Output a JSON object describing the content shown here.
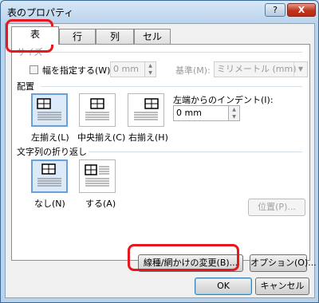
{
  "window": {
    "title": "表のプロパティ",
    "help_label": "?",
    "close_label": "X"
  },
  "tabs": [
    {
      "label": "表",
      "active": true
    },
    {
      "label": "行",
      "active": false
    },
    {
      "label": "列",
      "active": false
    },
    {
      "label": "セル",
      "active": false
    }
  ],
  "size": {
    "group_label": "サイズ",
    "width_checkbox_label": "幅を指定する(W):",
    "width_value": "0 mm",
    "unit_label": "基準(M):",
    "unit_value": "ミリメートル (mm)"
  },
  "alignment": {
    "group_label": "配置",
    "options": [
      {
        "label": "左揃え(L)",
        "selected": true
      },
      {
        "label": "中央揃え(C)",
        "selected": false
      },
      {
        "label": "右揃え(H)",
        "selected": false
      }
    ],
    "indent_label": "左端からのインデント(I):",
    "indent_value": "0 mm"
  },
  "wrapping": {
    "group_label": "文字列の折り返し",
    "options": [
      {
        "label": "なし(N)",
        "selected": true
      },
      {
        "label": "する(A)",
        "selected": false
      }
    ],
    "position_button": "位置(P)..."
  },
  "buttons": {
    "borders_shading": "線種/網かけの変更(B)...",
    "options": "オプション(O)...",
    "ok": "OK",
    "cancel": "キャンセル"
  },
  "colors": {
    "highlight": "#e8171e",
    "selection": "#6aa0d8"
  }
}
